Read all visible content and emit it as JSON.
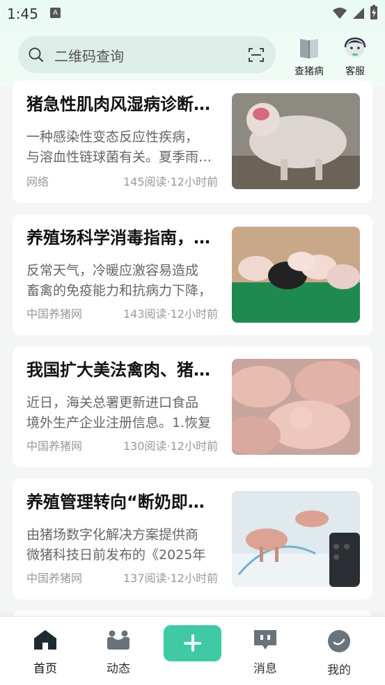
{
  "status": {
    "time": "1:45",
    "notif_glyph": "A"
  },
  "search": {
    "placeholder": "二维码查询"
  },
  "top_actions": {
    "disease": "查猪病",
    "service": "客服"
  },
  "articles": [
    {
      "title": "猪急性肌肉风湿病诊断与防治",
      "desc1": "一种感染性变态反应性疾病，",
      "desc2": "与溶血性链球菌有关。夏季雨水多",
      "source": "网络",
      "meta": "145阅读·12小时前"
    },
    {
      "title": "养殖场科学消毒指南，防患于未然",
      "desc1": "反常天气，冷暖应激容易造成",
      "desc2": "畜禽的免疫能力和抗病力下降，",
      "source": "中国养猪网",
      "meta": "143阅读·12小时前"
    },
    {
      "title": "我国扩大美法禽肉、猪肉进口",
      "desc1": "近日，海关总署更新进口食品",
      "desc2": "境外生产企业注册信息。1.恢复",
      "source": "中国养猪网",
      "meta": "130阅读·12小时前"
    },
    {
      "title": "养殖管理转向“断奶即出栏”",
      "desc1": "由猪场数字化解决方案提供商",
      "desc2": "微猪科技日前发布的《2025年",
      "source": "中国养猪网",
      "meta": "137阅读·12小时前"
    }
  ],
  "tabs": {
    "home": "首页",
    "feed": "动态",
    "messages": "消息",
    "mine": "我的"
  },
  "colors": {
    "accent": "#3fc9a4",
    "header_bg": "#eafaf4"
  }
}
